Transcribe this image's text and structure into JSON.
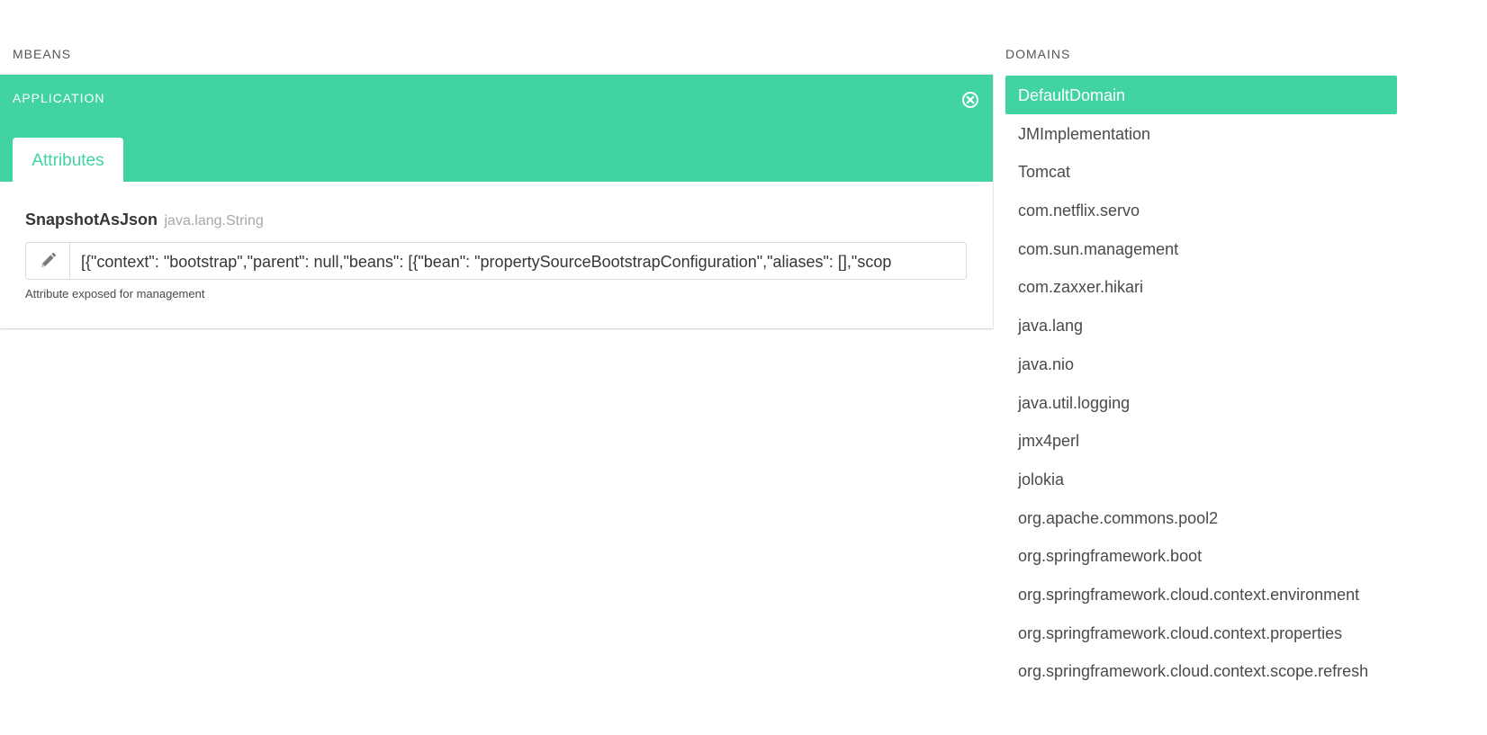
{
  "mbeans": {
    "heading": "MBEANS",
    "card": {
      "title": "APPLICATION",
      "close_icon": "close-circle-icon",
      "tabs": [
        {
          "label": "Attributes",
          "active": true
        }
      ],
      "attribute": {
        "name": "SnapshotAsJson",
        "type": "java.lang.String",
        "edit_icon": "pencil-icon",
        "value": "[{\"context\": \"bootstrap\",\"parent\": null,\"beans\": [{\"bean\": \"propertySourceBootstrapConfiguration\",\"aliases\": [],\"scop",
        "description": "Attribute exposed for management"
      }
    }
  },
  "domains": {
    "heading": "DOMAINS",
    "active_index": 0,
    "items": [
      "DefaultDomain",
      "JMImplementation",
      "Tomcat",
      "com.netflix.servo",
      "com.sun.management",
      "com.zaxxer.hikari",
      "java.lang",
      "java.nio",
      "java.util.logging",
      "jmx4perl",
      "jolokia",
      "org.apache.commons.pool2",
      "org.springframework.boot",
      "org.springframework.cloud.context.environment",
      "org.springframework.cloud.context.properties",
      "org.springframework.cloud.context.scope.refresh"
    ]
  },
  "colors": {
    "accent": "#42d3a5",
    "text": "#363636",
    "muted": "#a8a8a8",
    "border": "#dbdbdb"
  }
}
